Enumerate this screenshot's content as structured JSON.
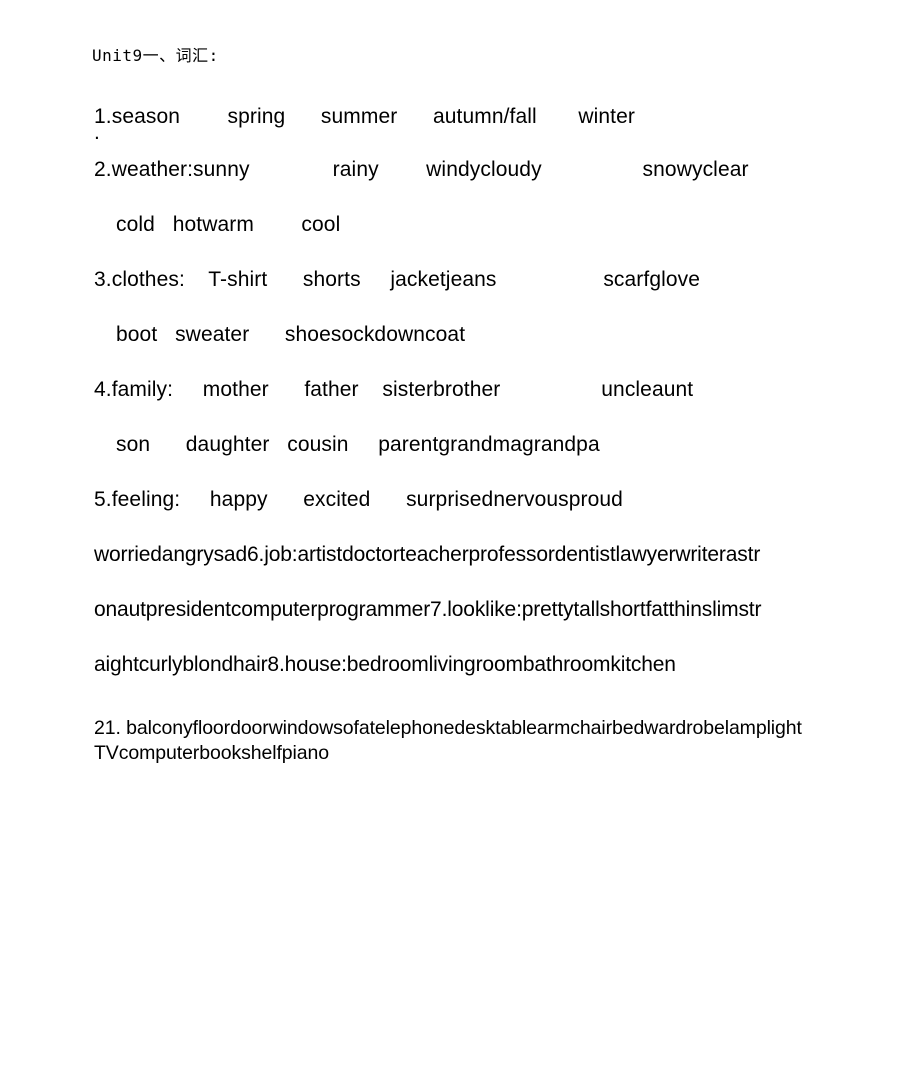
{
  "document": {
    "title": "Unit9一、词汇:",
    "page_background": "#ffffff",
    "text_color": "#000000"
  },
  "vocab_lines": [
    {
      "id": "season",
      "text": "1.season        spring      summer      autumn/fall       winter",
      "indent": false,
      "runon": false
    },
    {
      "id": "stray-dot",
      "text": ".",
      "indent": false,
      "runon": false
    },
    {
      "id": "weather",
      "text": "2.weather:sunny              rainy        windycloudy                 snowyclear",
      "indent": false,
      "runon": false
    },
    {
      "id": "weather-cont",
      "text": "cold   hotwarm        cool",
      "indent": true,
      "runon": false
    },
    {
      "id": "clothes",
      "text": "3.clothes:    T-shirt      shorts     jacketjeans                  scarfglove",
      "indent": false,
      "runon": false
    },
    {
      "id": "clothes-cont",
      "text": "boot   sweater      shoesockdowncoat",
      "indent": true,
      "runon": false
    },
    {
      "id": "family",
      "text": "4.family:     mother      father    sisterbrother                 uncleaunt",
      "indent": false,
      "runon": false
    },
    {
      "id": "family-cont",
      "text": "son      daughter   cousin     parentgrandmagrandpa",
      "indent": true,
      "runon": false
    },
    {
      "id": "feeling",
      "text": "5.feeling:     happy      excited      surprisednervousproud",
      "indent": false,
      "runon": false
    },
    {
      "id": "job-run-1",
      "text": "worriedangrysad6.job:artistdoctorteacherprofessordentistlawyerwriterastr",
      "indent": false,
      "runon": true
    },
    {
      "id": "job-run-2",
      "text": "onautpresidentcomputerprogrammer7.looklike:prettytallshortfatthinslimstr",
      "indent": false,
      "runon": true
    },
    {
      "id": "house-run",
      "text": "aightcurlyblondhair8.house:bedroomlivingroombathroomkitchen",
      "indent": false,
      "runon": true
    }
  ],
  "tail_paragraph": {
    "id": "furniture-run",
    "text": "21. balconyfloordoorwindowsofatelephonedesktablearmchairbedwardrobelamplightTVcomputerbookshelfpiano"
  }
}
